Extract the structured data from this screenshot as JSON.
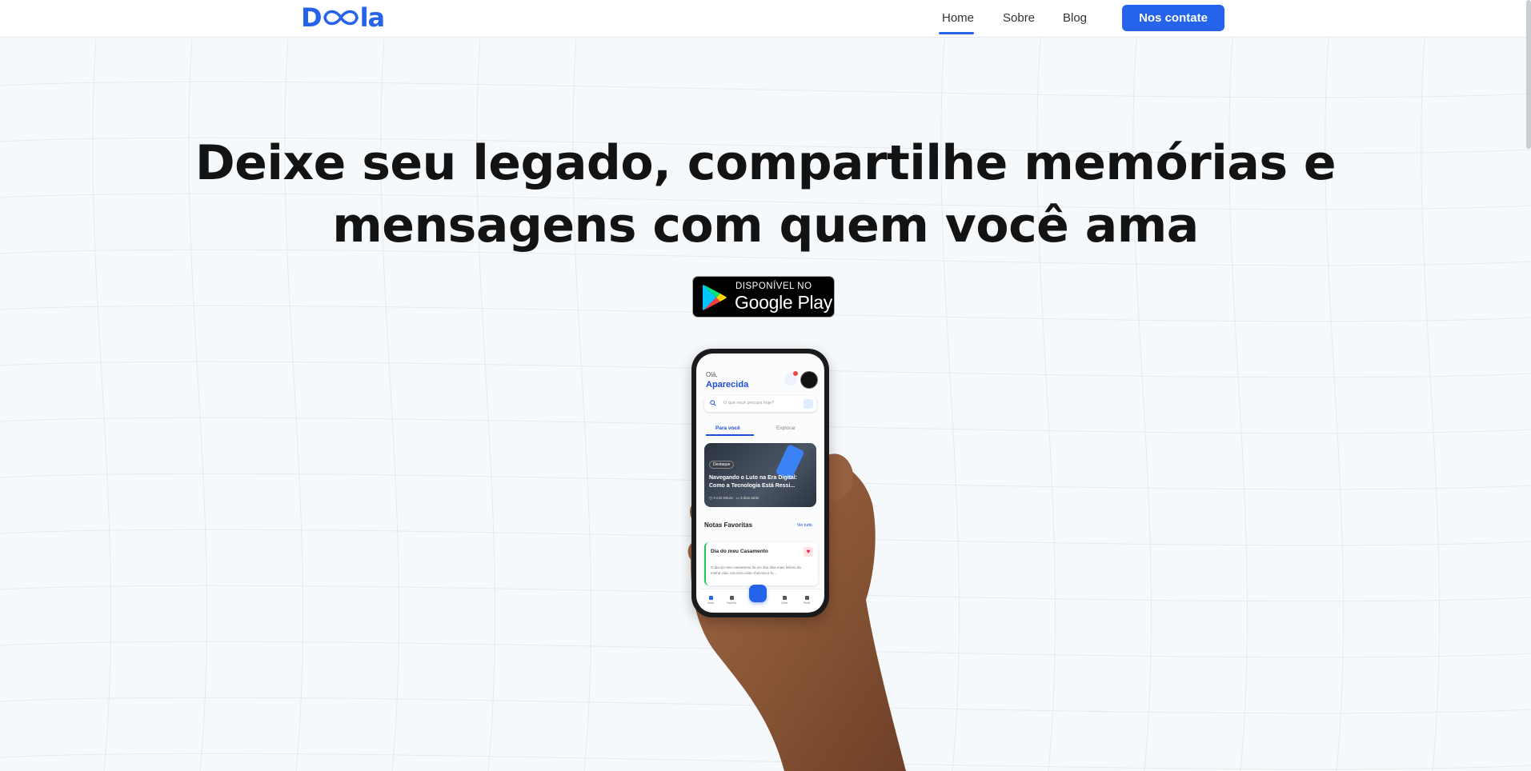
{
  "brand": {
    "logo_prefix": "D",
    "logo_suffix": "la",
    "accent_color": "#2563eb"
  },
  "nav": {
    "links": [
      {
        "label": "Home",
        "active": true
      },
      {
        "label": "Sobre",
        "active": false
      },
      {
        "label": "Blog",
        "active": false
      }
    ],
    "cta_label": "Nos contate"
  },
  "hero": {
    "title_line1": "Deixe seu legado, compartilhe memórias e",
    "title_line2": "mensagens com quem você ama",
    "store_badge": {
      "small_text": "DISPONÍVEL NO",
      "big_text": "Google Play",
      "icon": "google-play-icon"
    }
  },
  "phone_app": {
    "greeting": "Olá,",
    "user_name": "Aparecida",
    "search_placeholder": "O que você procura hoje?",
    "tabs": [
      "Para você",
      "Explorar"
    ],
    "featured": {
      "badge": "Destaque",
      "title_line1": "Navegando o Luto na Era Digital:",
      "title_line2": "Como a Tecnologia Está Ressi...",
      "read_time": "4 min leitura",
      "date": "3 dias atrás"
    },
    "favorites_heading": "Notas Favoritas",
    "see_all": "Ver tudo",
    "note": {
      "title": "Dia do meu Casamento",
      "body": "O dia do meu casamento foi um dos dias mais felizes da minha vida, era uma noite chuvosa e fo..."
    },
    "bottom_nav": [
      "Início",
      "Família",
      "Cofre",
      "Perfil"
    ]
  }
}
